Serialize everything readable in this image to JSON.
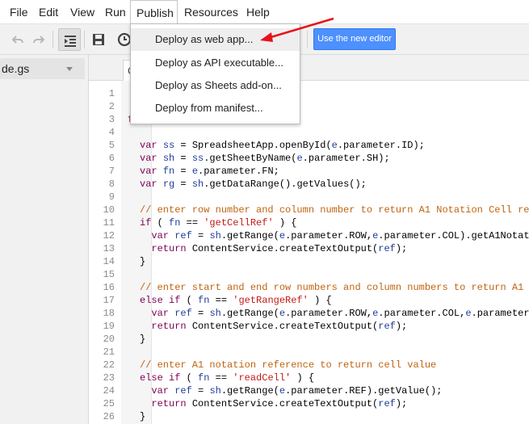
{
  "menubar": {
    "items": [
      {
        "label": "File"
      },
      {
        "label": "Edit"
      },
      {
        "label": "View"
      },
      {
        "label": "Run"
      },
      {
        "label": "Publish"
      },
      {
        "label": "Resources"
      },
      {
        "label": "Help"
      }
    ]
  },
  "toolbar": {
    "new_editor_label": "Use the new editor"
  },
  "sidebar": {
    "file_name": "de.gs"
  },
  "tab": {
    "label": "C"
  },
  "publish_menu": {
    "items": [
      {
        "label": "Deploy as web app..."
      },
      {
        "label": "Deploy as API executable..."
      },
      {
        "label": "Deploy as Sheets add-on..."
      },
      {
        "label": "Deploy from manifest..."
      }
    ]
  },
  "editor": {
    "line_numbers": [
      "1",
      "2",
      "3",
      "4",
      "5",
      "6",
      "7",
      "8",
      "9",
      "10",
      "11",
      "12",
      "13",
      "14",
      "15",
      "16",
      "17",
      "18",
      "19",
      "20",
      "21",
      "22",
      "23",
      "24",
      "25",
      "26"
    ],
    "partial_line_3": "f",
    "lines": {
      "l5": {
        "a": "var ",
        "b": "ss",
        "c": " = SpreadsheetApp.openById(",
        "d": "e",
        ".e": "",
        "e": ".parameter.ID);"
      },
      "l6": {
        "a": "var ",
        "b": "sh",
        "c": " = ",
        "d": "ss",
        "e": ".getSheetByName(",
        "f": "e",
        "g": ".parameter.SH);"
      },
      "l7": {
        "a": "var ",
        "b": "fn",
        "c": " = ",
        "d": "e",
        "e": ".parameter.FN;"
      },
      "l8": {
        "a": "var ",
        "b": "rg",
        "c": " = ",
        "d": "sh",
        "e": ".getDataRange().getValues();"
      },
      "l10": {
        "a": "// enter row number and column number to return A1 Notation Cell re"
      },
      "l11": {
        "a": "if",
        "b": " ( ",
        "c": "fn",
        "d": " == ",
        "e": "'getCellRef'",
        "f": " ) {"
      },
      "l12": {
        "a": "  var ",
        "b": "ref",
        "c": " = ",
        "d": "sh",
        "e": ".getRange(",
        "f": "e",
        "g": ".parameter.ROW,",
        "h": "e",
        "i": ".parameter.COL).getA1Notat"
      },
      "l13": {
        "a": "  return ",
        "b": "ContentService.createTextOutput(",
        "c": "ref",
        "d": ");"
      },
      "l14": {
        "a": "}"
      },
      "l16": {
        "a": "// enter start and end row numbers and column numbers to return A1"
      },
      "l17": {
        "a": "else if",
        "b": " ( ",
        "c": "fn",
        "d": " == ",
        "e": "'getRangeRef'",
        "f": " ) {"
      },
      "l18": {
        "a": "  var ",
        "b": "ref",
        "c": " = ",
        "d": "sh",
        "e": ".getRange(",
        "f": "e",
        "g": ".parameter.ROW,",
        "h": "e",
        "i": ".parameter.COL,",
        "j": "e",
        "k": ".parameter"
      },
      "l19": {
        "a": "  return ",
        "b": "ContentService.createTextOutput(",
        "c": "ref",
        "d": ");"
      },
      "l20": {
        "a": "}"
      },
      "l22": {
        "a": "// enter A1 notation reference to return cell value"
      },
      "l23": {
        "a": "else if",
        "b": " ( ",
        "c": "fn",
        "d": " == ",
        "e": "'readCell'",
        "f": " ) {"
      },
      "l24": {
        "a": "  var ",
        "b": "ref",
        "c": " = ",
        "d": "sh",
        "e": ".getRange(",
        "f": "e",
        "g": ".parameter.REF).getValue();"
      },
      "l25": {
        "a": "  return ",
        "b": "ContentService.createTextOutput(",
        "c": "ref",
        "d": ");"
      },
      "l26": {
        "a": "}"
      }
    }
  },
  "colors": {
    "accent_button": "#4d90fe",
    "arrow": "#e8121a",
    "keyword": "#7f0055",
    "string": "#c41a16",
    "comment": "#c1630f",
    "variable": "#1f3d9a"
  }
}
